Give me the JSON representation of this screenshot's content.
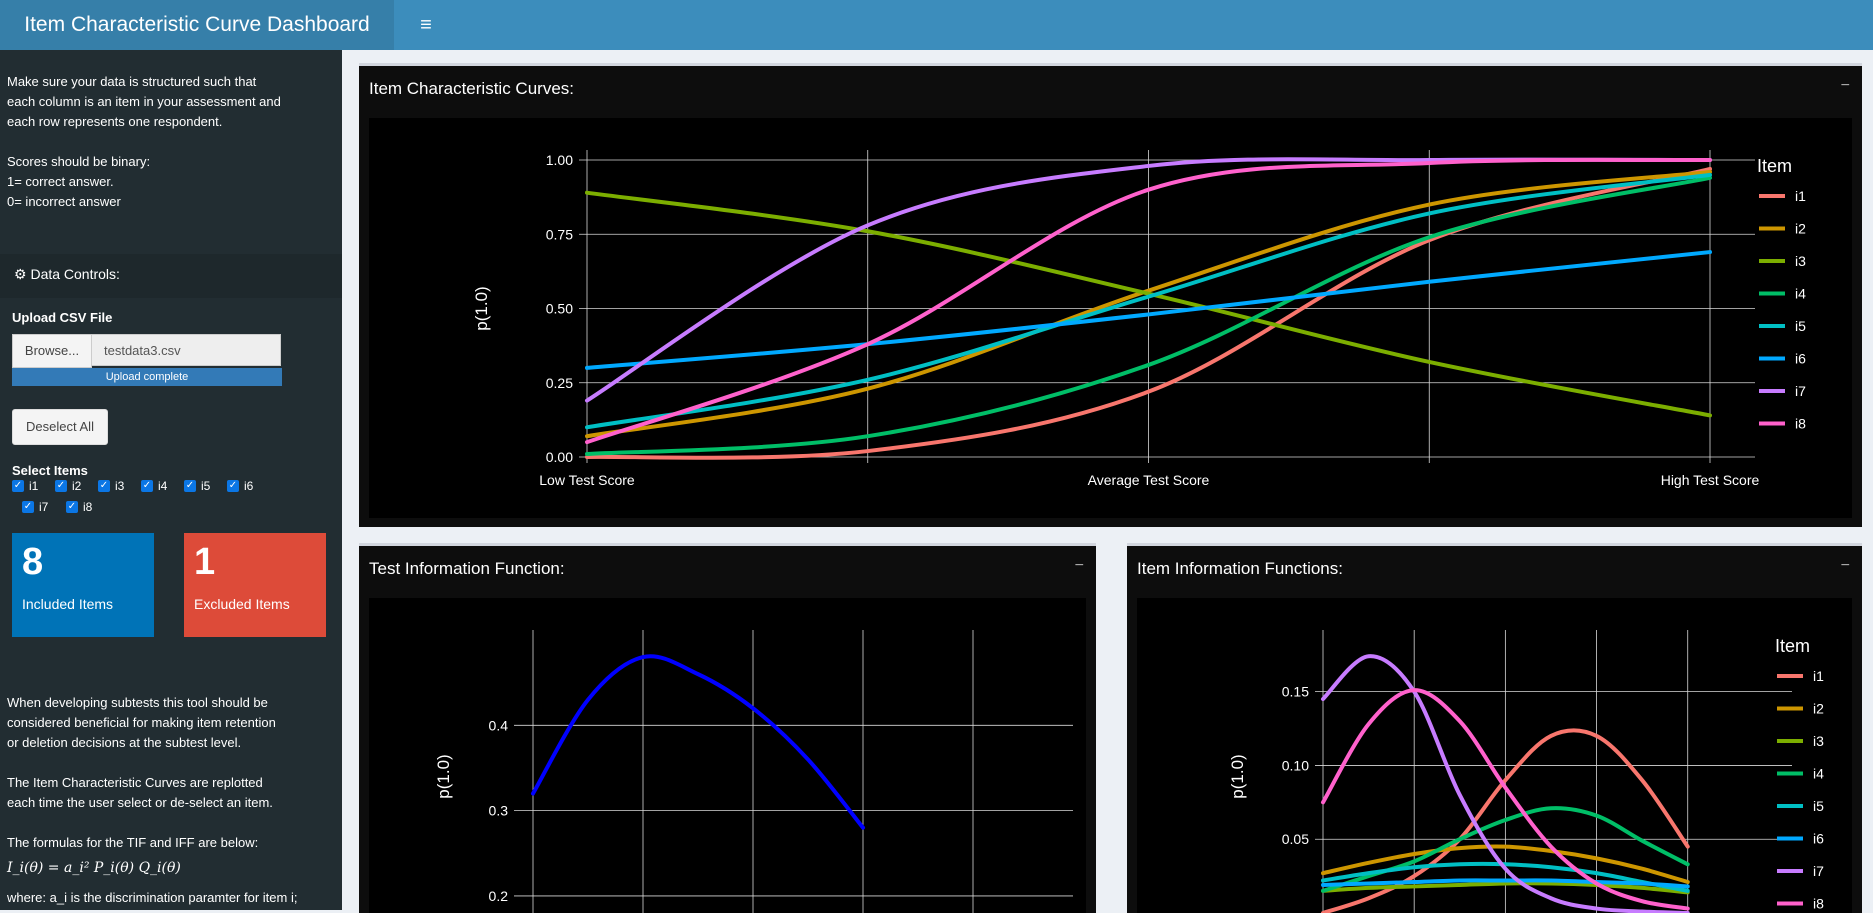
{
  "app": {
    "title": "Item Characteristic Curve Dashboard",
    "menu_icon": "hamburger-icon"
  },
  "sidebar": {
    "intro_lines": [
      "Make sure your data is structured such that",
      "each column is an item in your assessment and",
      "each row represents one respondent.",
      "",
      "Scores should be binary:",
      "1= correct answer.",
      "0= incorrect answer"
    ],
    "data_controls": {
      "icon": "gear-icon",
      "label": "Data Controls:"
    },
    "upload": {
      "label": "Upload CSV File",
      "browse": "Browse...",
      "file_name": "testdata3.csv",
      "status": "Upload complete"
    },
    "deselect_label": "Deselect All",
    "select_label": "Select Items",
    "items": [
      {
        "label": "i1",
        "checked": true
      },
      {
        "label": "i2",
        "checked": true
      },
      {
        "label": "i3",
        "checked": true
      },
      {
        "label": "i4",
        "checked": true
      },
      {
        "label": "i5",
        "checked": true
      },
      {
        "label": "i6",
        "checked": true
      },
      {
        "label": "i7",
        "checked": true
      },
      {
        "label": "i8",
        "checked": true
      }
    ],
    "included": {
      "value": "8",
      "label": "Included Items",
      "color": "#0073b7"
    },
    "excluded": {
      "value": "1",
      "label": "Excluded Items",
      "color": "#dd4b39"
    },
    "notes": [
      "When developing subtests this tool should be",
      "considered beneficial for making item retention",
      "or deletion decisions at the subtest level.",
      "",
      "The Item Characteristic Curves are replotted",
      "each time the user select or de-select an item.",
      "",
      "The formulas for the TIF and IFF are below:"
    ],
    "formula": "I_i(θ) = a_i² P_i(θ) Q_i(θ)",
    "formula_note": "where: a_i is the discrimination paramter for item i;"
  },
  "panels": {
    "icc": {
      "title": "Item Characteristic Curves:",
      "collapse": "−"
    },
    "tif": {
      "title": "Test Information Function:",
      "collapse": "−"
    },
    "iif": {
      "title": "Item Information Functions:",
      "collapse": "−"
    }
  },
  "chart_data": [
    {
      "type": "line",
      "ylabel": "p(1.0)",
      "x_tick_labels": [
        "Low Test Score",
        "Average Test Score",
        "High Test Score"
      ],
      "y_ticks": [
        "0.00",
        "0.25",
        "0.50",
        "0.75",
        "1.00"
      ],
      "ylim": [
        0,
        1
      ],
      "legend_title": "Item",
      "legend_position": "right",
      "grid": true,
      "x": [
        -2,
        -1,
        0,
        1,
        2
      ],
      "series": [
        {
          "name": "i1",
          "color": "#f8766d",
          "values": [
            0.0,
            0.02,
            0.22,
            0.73,
            0.97
          ]
        },
        {
          "name": "i2",
          "color": "#cd9600",
          "values": [
            0.07,
            0.23,
            0.56,
            0.85,
            0.96
          ]
        },
        {
          "name": "i3",
          "color": "#7cae00",
          "values": [
            0.89,
            0.76,
            0.55,
            0.32,
            0.14
          ]
        },
        {
          "name": "i4",
          "color": "#00be67",
          "values": [
            0.01,
            0.07,
            0.31,
            0.74,
            0.94
          ]
        },
        {
          "name": "i5",
          "color": "#00bfc4",
          "values": [
            0.1,
            0.26,
            0.54,
            0.82,
            0.95
          ]
        },
        {
          "name": "i6",
          "color": "#00a9ff",
          "values": [
            0.3,
            0.38,
            0.48,
            0.59,
            0.69
          ]
        },
        {
          "name": "i7",
          "color": "#c77cff",
          "values": [
            0.19,
            0.78,
            0.98,
            1.0,
            1.0
          ]
        },
        {
          "name": "i8",
          "color": "#ff61cc",
          "values": [
            0.05,
            0.38,
            0.9,
            0.99,
            1.0
          ]
        }
      ]
    },
    {
      "type": "line",
      "ylabel": "p(1.0)",
      "y_ticks": [
        "0.2",
        "0.3",
        "0.4"
      ],
      "grid": true,
      "series": [
        {
          "color": "#0000ff",
          "x": [
            -3,
            -2.5,
            -2,
            -1.5,
            -1,
            -0.5,
            0
          ],
          "values": [
            0.32,
            0.43,
            0.48,
            0.46,
            0.42,
            0.36,
            0.28
          ]
        }
      ]
    },
    {
      "type": "line",
      "ylabel": "p(1.0)",
      "y_ticks": [
        "0.05",
        "0.10",
        "0.15"
      ],
      "legend_title": "Item",
      "legend_position": "right",
      "grid": true,
      "x": [
        -3,
        -2.5,
        -2,
        -1.5,
        -1,
        -0.5,
        0,
        0.5,
        1
      ],
      "series": [
        {
          "name": "i1",
          "color": "#f8766d",
          "values": [
            0.0,
            0.01,
            0.025,
            0.05,
            0.09,
            0.12,
            0.12,
            0.09,
            0.045
          ]
        },
        {
          "name": "i2",
          "color": "#cd9600",
          "values": [
            0.027,
            0.034,
            0.04,
            0.044,
            0.045,
            0.042,
            0.037,
            0.03,
            0.021
          ]
        },
        {
          "name": "i3",
          "color": "#7cae00",
          "values": [
            0.015,
            0.017,
            0.018,
            0.019,
            0.02,
            0.02,
            0.019,
            0.017,
            0.014
          ]
        },
        {
          "name": "i4",
          "color": "#00be67",
          "values": [
            0.015,
            0.025,
            0.035,
            0.05,
            0.063,
            0.071,
            0.066,
            0.049,
            0.033
          ]
        },
        {
          "name": "i5",
          "color": "#00bfc4",
          "values": [
            0.022,
            0.027,
            0.031,
            0.033,
            0.033,
            0.031,
            0.027,
            0.021,
            0.015
          ]
        },
        {
          "name": "i6",
          "color": "#00a9ff",
          "values": [
            0.019,
            0.02,
            0.021,
            0.022,
            0.022,
            0.022,
            0.021,
            0.02,
            0.018
          ]
        },
        {
          "name": "i7",
          "color": "#c77cff",
          "values": [
            0.145,
            0.174,
            0.15,
            0.08,
            0.03,
            0.01,
            0.003,
            0.001,
            0.0
          ]
        },
        {
          "name": "i8",
          "color": "#ff61cc",
          "values": [
            0.075,
            0.128,
            0.151,
            0.13,
            0.085,
            0.045,
            0.02,
            0.008,
            0.003
          ]
        }
      ]
    }
  ]
}
